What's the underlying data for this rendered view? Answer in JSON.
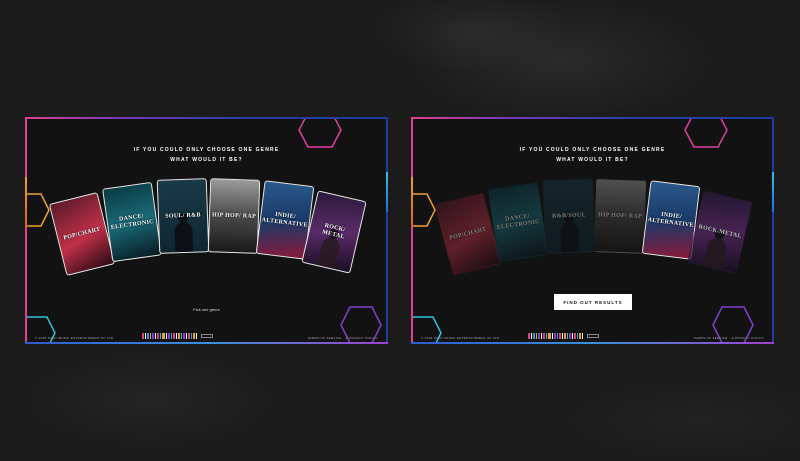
{
  "screens": [
    {
      "heading_line1": "IF YOU COULD ONLY CHOOSE ONE GENRE",
      "heading_line2": "WHAT WOULD IT BE?",
      "cards": [
        "POP/CHART",
        "DANCE/ ELECTRONIC",
        "SOUL/ R&B",
        "HIP HOP/ RAP",
        "INDIE/ ALTERNATIVE",
        "ROCK/ METAL"
      ],
      "pick_text": "Pick one genre",
      "footer_copyright": "© 2018 SONY MUSIC ENTERTAINMENT UK LTD",
      "footer_terms": "TERMS OF SERVICE",
      "footer_privacy": "& PRIVACY POLICY"
    },
    {
      "heading_line1": "IF YOU COULD ONLY CHOOSE ONE GENRE",
      "heading_line2": "WHAT WOULD IT BE?",
      "cards": [
        "POP/CHART",
        "DANCE/ ELECTRONIC",
        "R&B/SOUL",
        "HIP HOP/ RAP",
        "INDIE/ ALTERNATIVE",
        "ROCK/METAL"
      ],
      "selected_card": "INDIE/ ALTERNATIVE",
      "button_label": "FIND OUT RESULTS",
      "footer_copyright": "© 2018 SONY MUSIC ENTERTAINMENT UK LTD",
      "footer_terms": "TERMS OF SERVICE",
      "footer_privacy": "& PRIVACY POLICY"
    }
  ],
  "colors": {
    "frame_pink": "#e0428a",
    "frame_blue": "#1f3c9e",
    "hex_orange": "#f0a030",
    "hex_pink": "#e040a0",
    "hex_cyan": "#30c0e0",
    "hex_purple": "#8040d0"
  }
}
